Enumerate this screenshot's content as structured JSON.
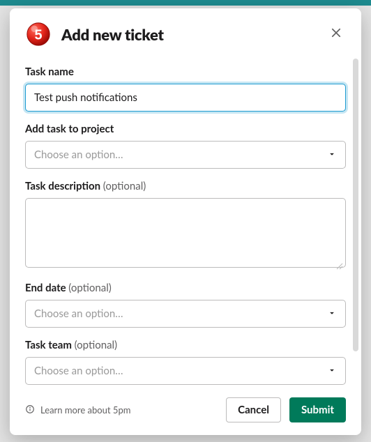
{
  "modal": {
    "title": "Add new ticket",
    "logo_number": "5"
  },
  "fields": {
    "task_name": {
      "label": "Task name",
      "value": "Test push notifications"
    },
    "project": {
      "label": "Add task to project",
      "placeholder": "Choose an option…"
    },
    "description": {
      "label": "Task description",
      "optional": "(optional)",
      "value": ""
    },
    "end_date": {
      "label": "End date",
      "optional": "(optional)",
      "placeholder": "Choose an option…"
    },
    "team": {
      "label": "Task team",
      "optional": "(optional)",
      "placeholder": "Choose an option…"
    }
  },
  "footer": {
    "learn_more": "Learn more about 5pm",
    "cancel": "Cancel",
    "submit": "Submit"
  }
}
